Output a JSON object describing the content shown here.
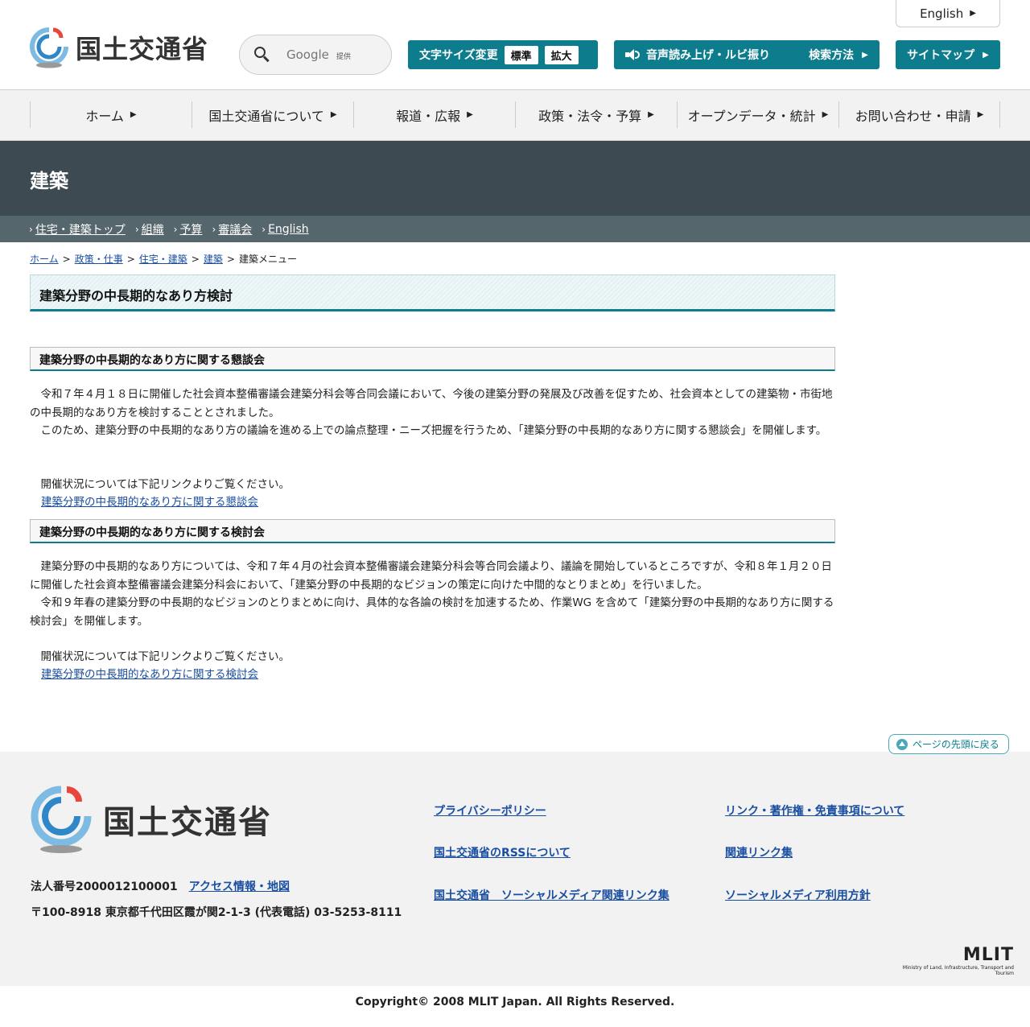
{
  "header": {
    "logo_text": "国土交通省",
    "english_label": "English",
    "search": {
      "placeholder": "Google",
      "provided": "提供"
    },
    "font_size": {
      "label": "文字サイズ変更",
      "standard": "標準",
      "large": "拡大"
    },
    "voice_label": "音声読み上げ・ルビ振り",
    "how_search_label": "検索方法",
    "sitemap_label": "サイトマップ"
  },
  "gnav": {
    "items": [
      {
        "label": "ホーム"
      },
      {
        "label": "国土交通省について"
      },
      {
        "label": "報道・広報"
      },
      {
        "label": "政策・法令・予算"
      },
      {
        "label": "オープンデータ・統計"
      },
      {
        "label": "お問い合わせ・申請"
      }
    ]
  },
  "title_band": {
    "title": "建築"
  },
  "subnav": {
    "items": [
      {
        "label": "住宅・建築トップ"
      },
      {
        "label": "組織"
      },
      {
        "label": "予算"
      },
      {
        "label": "審議会"
      },
      {
        "label": "English"
      }
    ]
  },
  "breadcrumb": {
    "items": [
      {
        "label": "ホーム"
      },
      {
        "label": "政策・仕事"
      },
      {
        "label": "住宅・建築"
      },
      {
        "label": "建築"
      }
    ],
    "current": "建築メニュー"
  },
  "main": {
    "heading": "建築分野の中長期的なあり方検討",
    "section1": {
      "heading": "建築分野の中長期的なあり方に関する懇談会",
      "p1": "　令和７年４月１８日に開催した社会資本整備審議会建築分科会等合同会議において、今後の建築分野の発展及び改善を促すため、社会資本としての建築物・市街地の中長期的なあり方を検討することとされました。",
      "p2": "　このため、建築分野の中長期的なあり方の議論を進める上での論点整理・ニーズ把握を行うため、「建築分野の中長期的なあり方に関する懇談会」を開催します。",
      "p3": "　開催状況については下記リンクよりご覧ください。",
      "link": "建築分野の中長期的なあり方に関する懇談会"
    },
    "section2": {
      "heading": "建築分野の中長期的なあり方に関する検討会",
      "p1": "　建築分野の中長期的なあり方については、令和７年４月の社会資本整備審議会建築分科会等合同会議より、議論を開始しているところですが、令和８年１月２０日に開催した社会資本整備審議会建築分科会において、「建築分野の中長期的なビジョンの策定に向けた中間的なとりまとめ」を行いました。",
      "p2": "　令和９年春の建築分野の中長期的なビジョンのとりまとめに向け、具体的な各論の検討を加速するため、作業WG を含めて「建築分野の中長期的なあり方に関する検討会」を開催します。",
      "p3": "　開催状況については下記リンクよりご覧ください。",
      "link": "建築分野の中長期的なあり方に関する検討会"
    }
  },
  "back_to_top": "ページの先頭に戻る",
  "footer": {
    "logo_text": "国土交通省",
    "corp_number": "法人番号2000012100001",
    "access_link": "アクセス情報・地図",
    "address": "〒100-8918 東京都千代田区霞が関2-1-3 (代表電話) 03-5253-8111",
    "links": {
      "privacy": "プライバシーポリシー",
      "link_copyright": "リンク・著作権・免責事項について",
      "rss": "国土交通省のRSSについて",
      "related": "関連リンク集",
      "social_links": "国土交通省　ソーシャルメディア関連リンク集",
      "social_policy": "ソーシャルメディア利用方針"
    },
    "mlit_logo": "MLIT",
    "mlit_subtitle": "Ministry of Land, Infrastructure, Transport and Tourism",
    "copyright": "Copyright© 2008 MLIT Japan. All Rights Reserved."
  },
  "colors": {
    "accent": "#0d7d8e",
    "title_band": "#3d4a51",
    "subnav": "#56666d",
    "link": "#1a4ea0"
  }
}
